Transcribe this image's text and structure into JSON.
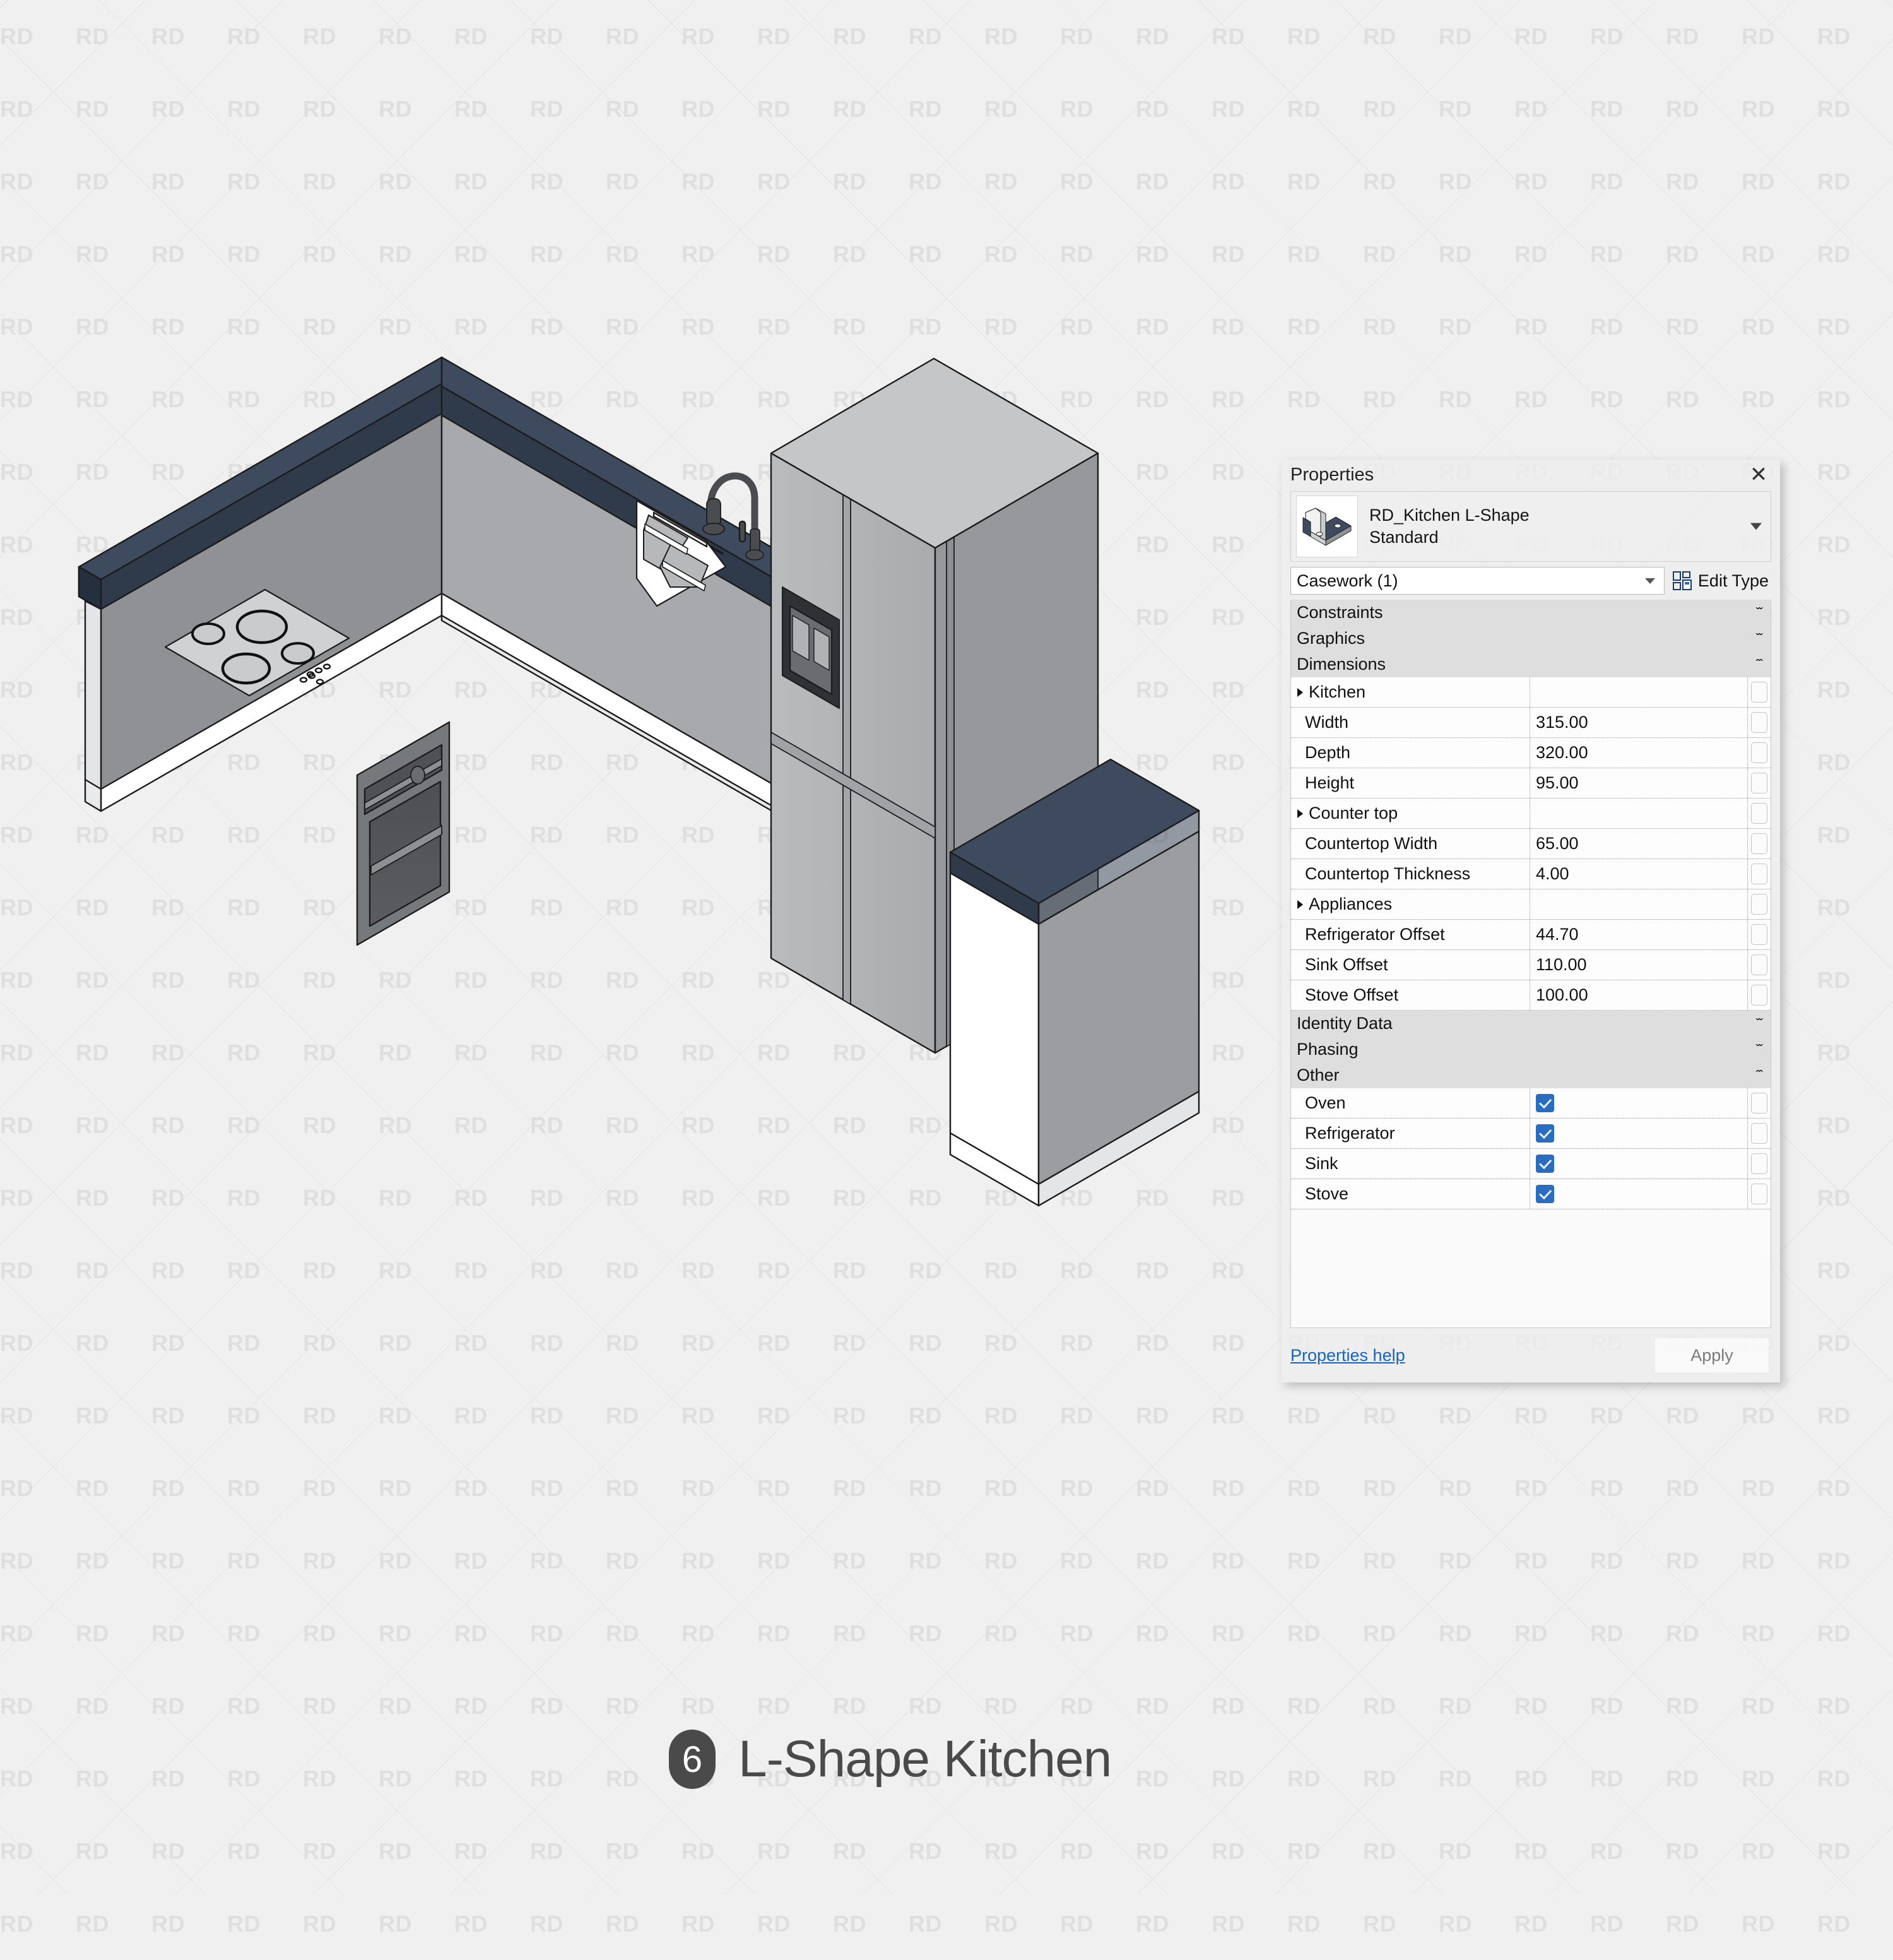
{
  "caption": {
    "number": "6",
    "title": "L-Shape Kitchen"
  },
  "watermark": {
    "text": "RD"
  },
  "properties_panel": {
    "title": "Properties",
    "close_label": "✕",
    "type_name_line1": "RD_Kitchen L-Shape",
    "type_name_line2": "Standard",
    "category": "Casework (1)",
    "edit_type_label": "Edit Type",
    "groups": [
      {
        "name": "Constraints",
        "state": "collapsed",
        "chevron": "ˇˇ"
      },
      {
        "name": "Graphics",
        "state": "collapsed",
        "chevron": "ˇˇ"
      },
      {
        "name": "Dimensions",
        "state": "expanded",
        "chevron": "ˆˆ"
      }
    ],
    "dimension_rows": [
      {
        "label": "Kitchen",
        "value": "",
        "header": true
      },
      {
        "label": "Width",
        "value": "315.00",
        "header": false
      },
      {
        "label": "Depth",
        "value": "320.00",
        "header": false
      },
      {
        "label": "Height",
        "value": "95.00",
        "header": false
      },
      {
        "label": "Counter top",
        "value": "",
        "header": true
      },
      {
        "label": "Countertop Width",
        "value": "65.00",
        "header": false
      },
      {
        "label": "Countertop Thickness",
        "value": "4.00",
        "header": false
      },
      {
        "label": "Appliances",
        "value": "",
        "header": true
      },
      {
        "label": "Refrigerator Offset",
        "value": "44.70",
        "header": false
      },
      {
        "label": "Sink Offset",
        "value": "110.00",
        "header": false
      },
      {
        "label": "Stove Offset",
        "value": "100.00",
        "header": false
      }
    ],
    "groups2": [
      {
        "name": "Identity Data",
        "state": "collapsed",
        "chevron": "ˇˇ"
      },
      {
        "name": "Phasing",
        "state": "collapsed",
        "chevron": "ˇˇ"
      },
      {
        "name": "Other",
        "state": "expanded",
        "chevron": "ˆˆ"
      }
    ],
    "other_rows": [
      {
        "label": "Oven",
        "checked": true
      },
      {
        "label": "Refrigerator",
        "checked": true
      },
      {
        "label": "Sink",
        "checked": true
      },
      {
        "label": "Stove",
        "checked": true
      }
    ],
    "help_label": "Properties help",
    "apply_label": "Apply"
  },
  "colors": {
    "countertop": "#3e4b5f",
    "countertop_edge": "#2f3a4b",
    "cabinet_front": "#8f9194",
    "cabinet_side": "#d9dadb",
    "appliance": "#b3b5b7",
    "accent_checkbox": "#2a6dc0",
    "link": "#1565c0",
    "badge": "#4a4a4a",
    "background": "#f0f0f0"
  }
}
